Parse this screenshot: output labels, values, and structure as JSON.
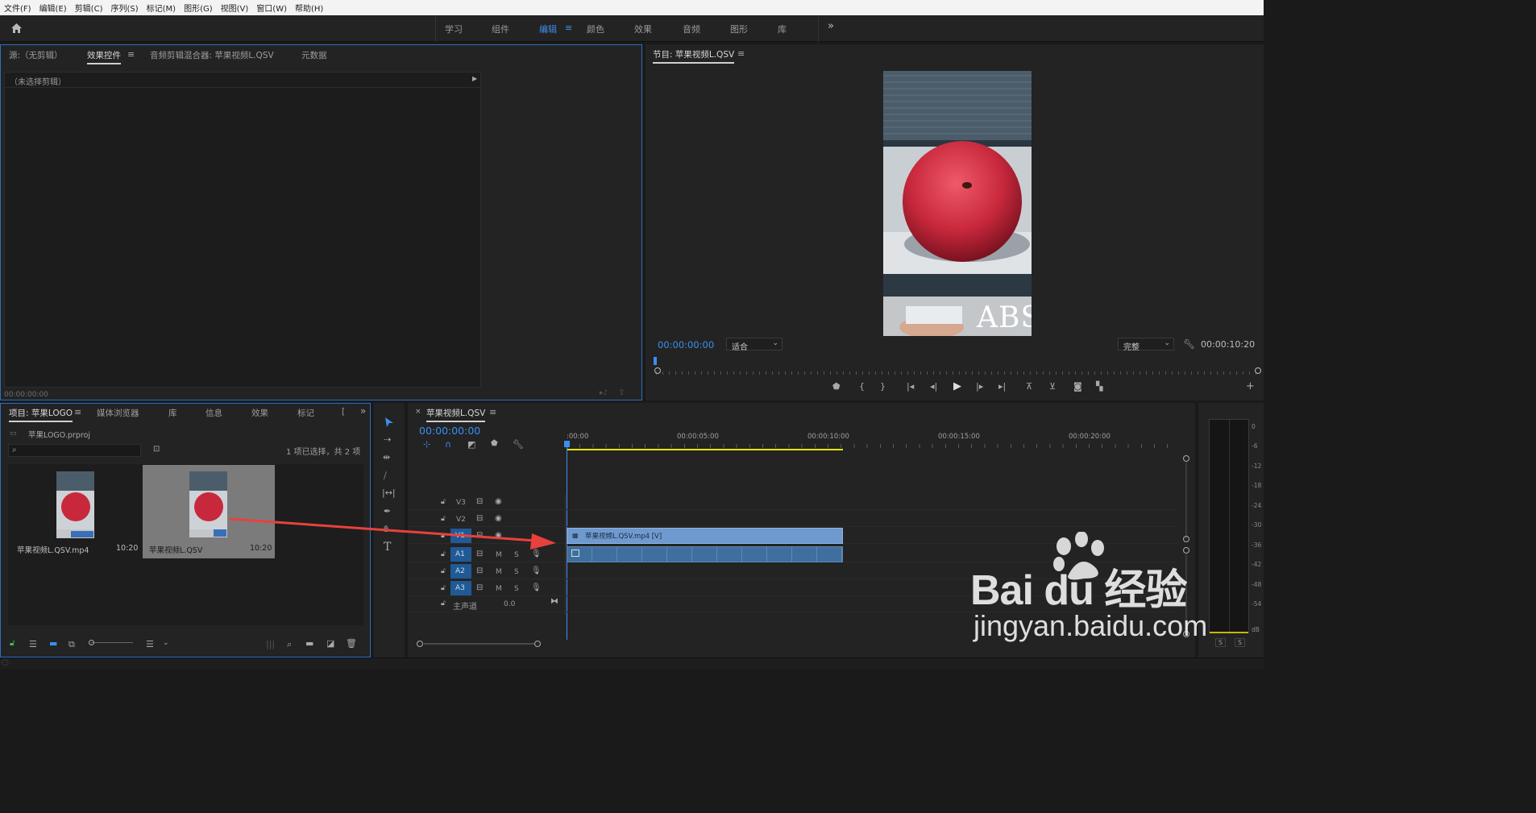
{
  "menu": [
    "文件(F)",
    "编辑(E)",
    "剪辑(C)",
    "序列(S)",
    "标记(M)",
    "图形(G)",
    "视图(V)",
    "窗口(W)",
    "帮助(H)"
  ],
  "workspaces": {
    "tabs": [
      "学习",
      "组件",
      "编辑",
      "颜色",
      "效果",
      "音频",
      "图形",
      "库"
    ],
    "active": "编辑",
    "menu_glyph": "≡",
    "more": "»"
  },
  "source_panel": {
    "tabs": [
      "源:（无剪辑）",
      "效果控件",
      "音频剪辑混合器: 苹果视频L.QSV",
      "元数据"
    ],
    "active_tab": "效果控件",
    "no_clip_text": "（未选择剪辑）",
    "timecode": "00:00:00:00"
  },
  "program_monitor": {
    "title": "节目: 苹果视频L.QSV",
    "timecode_current": "00:00:00:00",
    "fit_select": "适合",
    "quality_select": "完整",
    "timecode_duration": "00:00:10:20",
    "overlay_text": "ABS"
  },
  "project_panel": {
    "tabs": [
      "项目: 苹果LOGO",
      "媒体浏览器",
      "库",
      "信息",
      "效果",
      "标记",
      "["
    ],
    "active_tab": "项目: 苹果LOGO",
    "project_file": "苹果LOGO.prproj",
    "selection_info": "1 项已选择，共 2 项",
    "items": [
      {
        "name": "苹果视频L.QSV.mp4",
        "duration": "10:20",
        "selected": false
      },
      {
        "name": "苹果视频L.QSV",
        "duration": "10:20",
        "selected": true
      }
    ]
  },
  "timeline": {
    "sequence_name": "苹果视频L.QSV",
    "timecode": "00:00:00:00",
    "ruler": [
      ":00:00",
      "00:00:05:00",
      "00:00:10:00",
      "00:00:15:00",
      "00:00:20:00"
    ],
    "video_tracks": [
      "V3",
      "V2",
      "V1"
    ],
    "audio_tracks": [
      "A1",
      "A2",
      "A3"
    ],
    "master_label": "主声道",
    "master_value": "0.0",
    "clip_label": "苹果视频L.QSV.mp4 [V]",
    "mute": "M",
    "solo": "S"
  },
  "audio_meter": {
    "scale": [
      "0",
      "-6",
      "-12",
      "-18",
      "-24",
      "-30",
      "-36",
      "-42",
      "-48",
      "-54",
      "dB"
    ],
    "solo_buttons": [
      "S",
      "S"
    ]
  },
  "watermark": {
    "brand_text": "Bai du 经验",
    "url": "jingyan.baidu.com"
  },
  "colors": {
    "accent": "#3a8ff0",
    "clip_video": "#6f9ad0",
    "clip_audio": "#3e6f9e",
    "annotation_arrow": "#e8413c",
    "work_area": "#e6e600"
  }
}
